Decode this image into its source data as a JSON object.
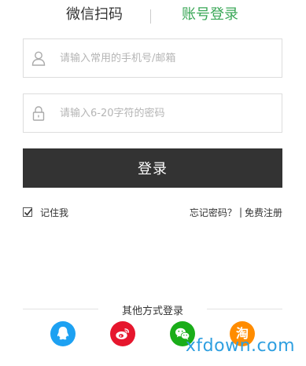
{
  "tabs": {
    "wechat_scan": "微信扫码",
    "account_login": "账号登录"
  },
  "form": {
    "phone_placeholder": "请输入常用的手机号/邮箱",
    "phone_value": "",
    "password_placeholder": "请输入6-20字符的密码",
    "password_value": "",
    "login_button": "登录",
    "remember_me": "记住我",
    "remember_checked": true,
    "forgot_password": "忘记密码？",
    "separator": "|",
    "register": "免费注册"
  },
  "other_login": {
    "title": "其他方式登录",
    "providers": [
      {
        "name": "QQ",
        "icon": "qq-icon",
        "color": "#1da1f2"
      },
      {
        "name": "Weibo",
        "icon": "weibo-icon",
        "color": "#e6162d"
      },
      {
        "name": "WeChat",
        "icon": "wechat-icon",
        "color": "#1aad19"
      },
      {
        "name": "Taobao",
        "icon": "taobao-icon",
        "color": "#ff8c00",
        "glyph": "淘"
      }
    ]
  },
  "watermark": "xfdown.com",
  "colors": {
    "accent_green": "#3aa757",
    "button_dark": "#333333",
    "border": "#dddddd",
    "watermark": "#2e9fe0"
  }
}
